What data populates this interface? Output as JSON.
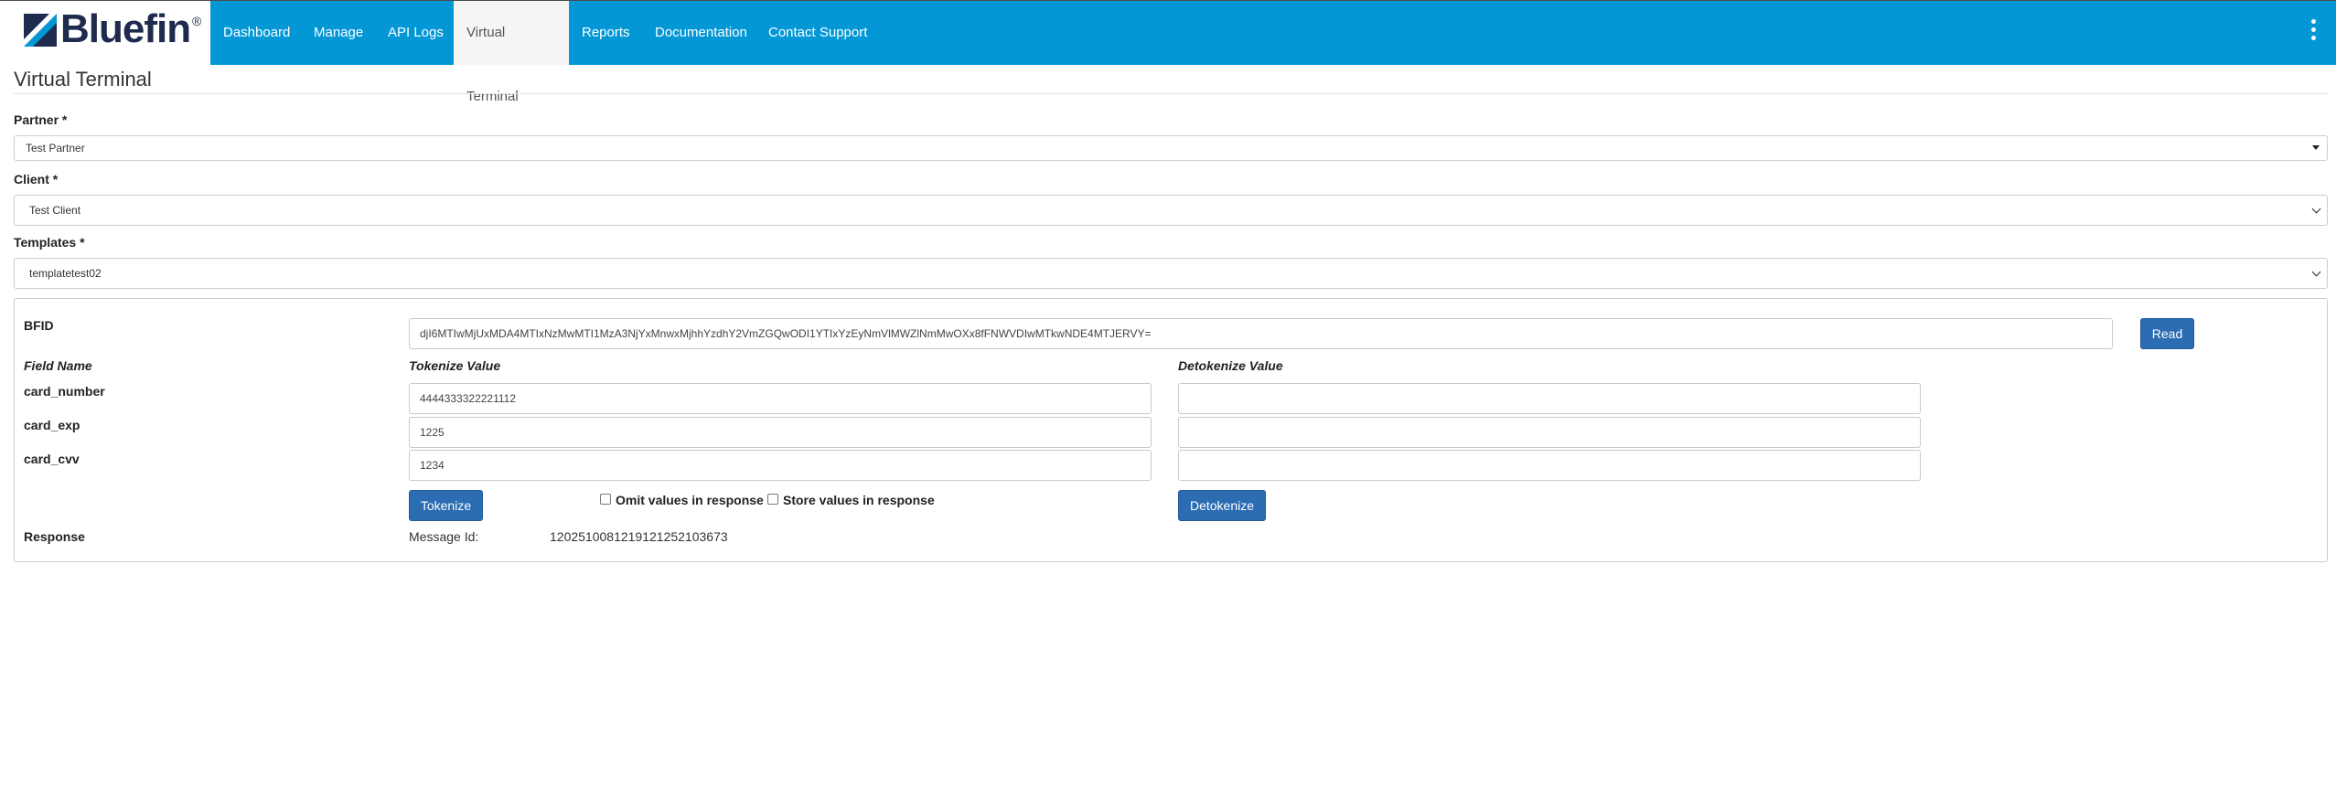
{
  "brand": {
    "name": "Bluefin",
    "registered": "®"
  },
  "nav": {
    "items": [
      {
        "label": "Dashboard"
      },
      {
        "label": "Manage"
      },
      {
        "label": "API Logs"
      },
      {
        "label": "Virtual Terminal",
        "active": true
      },
      {
        "label": "Reports"
      },
      {
        "label": "Documentation"
      },
      {
        "label": "Contact Support"
      }
    ],
    "menu_icon": "kebab-menu-icon"
  },
  "page": {
    "title": "Virtual Terminal"
  },
  "form": {
    "partner": {
      "label": "Partner *",
      "value": "Test Partner"
    },
    "client": {
      "label": "Client *",
      "value": "Test Client"
    },
    "templates": {
      "label": "Templates *",
      "value": "templatetest02"
    }
  },
  "panel": {
    "bfid": {
      "label": "BFID",
      "value": "djI6MTIwMjUxMDA4MTIxNzMwMTI1MzA3NjYxMnwxMjhhYzdhY2VmZGQwODI1YTIxYzEyNmVlMWZlNmMwOXx8fFNWVDIwMTkwNDE4MTJERVY=",
      "read_label": "Read"
    },
    "headers": {
      "field_name": "Field Name",
      "tokenize_value": "Tokenize Value",
      "detokenize_value": "Detokenize Value"
    },
    "rows": [
      {
        "name": "card_number",
        "tokenize": "4444333322221112",
        "detokenize": ""
      },
      {
        "name": "card_exp",
        "tokenize": "1225",
        "detokenize": ""
      },
      {
        "name": "card_cvv",
        "tokenize": "1234",
        "detokenize": ""
      }
    ],
    "tokenize_label": "Tokenize",
    "detokenize_label": "Detokenize",
    "omit_label": "Omit values in response",
    "store_label": "Store values in response",
    "response": {
      "label": "Response",
      "message_id_label": "Message Id:",
      "message_id": "1202510081219121252103673"
    }
  },
  "colors": {
    "navbar": "#0397d6",
    "button": "#2b6cb3",
    "brand_text": "#1e2a4e"
  }
}
